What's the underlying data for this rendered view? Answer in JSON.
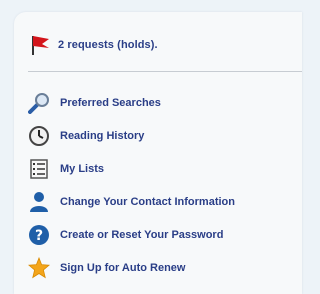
{
  "holds": {
    "label": "2 requests (holds).",
    "icon": "red-flag-icon",
    "color": "#d3151b"
  },
  "menu": [
    {
      "label": "Preferred Searches",
      "icon": "magnifier-icon"
    },
    {
      "label": "Reading History",
      "icon": "clock-icon"
    },
    {
      "label": "My Lists",
      "icon": "list-icon"
    },
    {
      "label": "Change Your Contact Information",
      "icon": "user-icon"
    },
    {
      "label": "Create or Reset Your Password",
      "icon": "help-icon"
    },
    {
      "label": "Sign Up for Auto Renew",
      "icon": "star-icon"
    }
  ],
  "colors": {
    "link": "#2a3e87",
    "background": "#edf3f8",
    "card": "#f7f9fa",
    "divider": "#c7ccd2",
    "accent": "#1f5fa8",
    "star": "#f3a51b"
  }
}
